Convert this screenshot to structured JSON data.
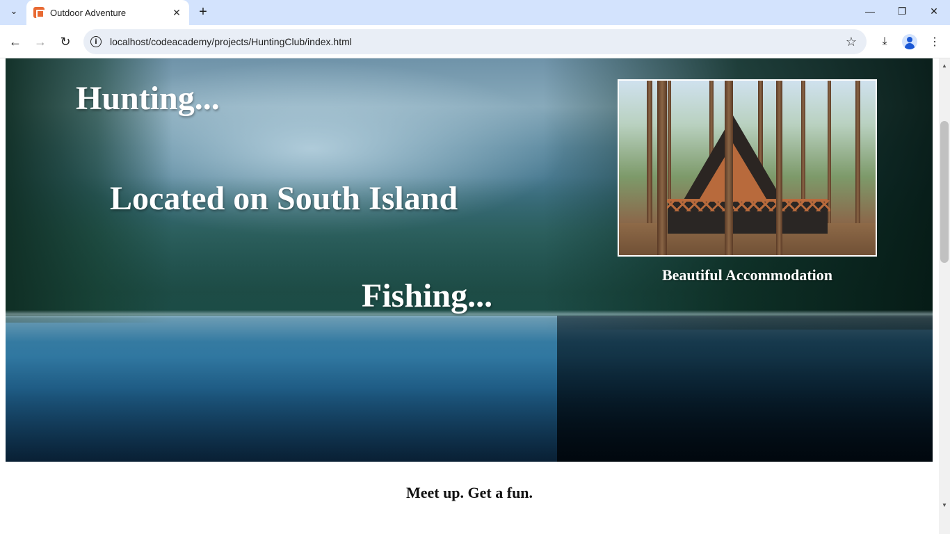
{
  "browser": {
    "tab_title": "Outdoor Adventure",
    "url": "localhost/codeacademy/projects/HuntingClub/index.html",
    "tab_search_icon": "chevron-down-icon",
    "new_tab_icon": "plus-icon",
    "icons": {
      "back": "arrow-left-icon",
      "forward": "arrow-right-icon",
      "reload": "reload-icon",
      "info": "info-icon",
      "bookmark": "star-icon",
      "download": "download-icon",
      "profile": "profile-icon",
      "menu": "kebab-menu-icon",
      "minimize": "minimize-icon",
      "restore": "restore-icon",
      "close": "close-icon"
    },
    "colors": {
      "tabstrip": "#d3e3fd",
      "omnibox": "#e9eef6",
      "profile_accent": "#1a57d4"
    }
  },
  "page": {
    "hero": {
      "heading_hunting": "Hunting...",
      "heading_location": "Located on South Island",
      "heading_fishing": "Fishing...",
      "photo_caption": "Beautiful Accommodation"
    },
    "tagline": "Meet up. Get a fun."
  }
}
